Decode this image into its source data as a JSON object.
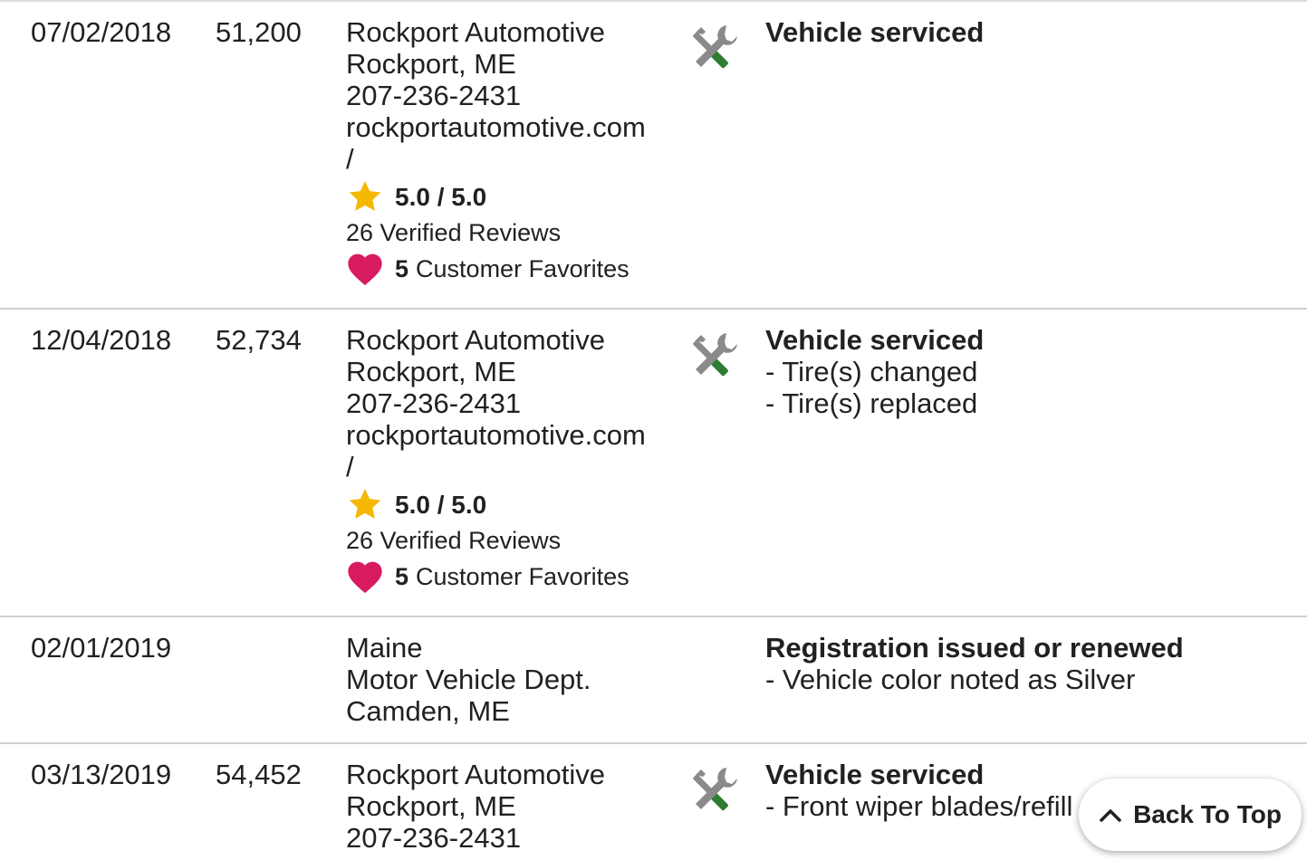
{
  "records": [
    {
      "date": "07/02/2018",
      "odometer": "51,200",
      "source": {
        "name": "Rockport Automotive",
        "location": "Rockport, ME",
        "phone": "207-236-2431",
        "website": "rockportautomotive.com",
        "website_tail": "/",
        "rating": "5.0 / 5.0",
        "reviews": "26 Verified Reviews",
        "favorites_count": "5",
        "favorites_label": "Customer Favorites"
      },
      "icon": "wrench-screwdriver-icon",
      "details": {
        "title": "Vehicle serviced",
        "items": []
      }
    },
    {
      "date": "12/04/2018",
      "odometer": "52,734",
      "source": {
        "name": "Rockport Automotive",
        "location": "Rockport, ME",
        "phone": "207-236-2431",
        "website": "rockportautomotive.com",
        "website_tail": "/",
        "rating": "5.0 / 5.0",
        "reviews": "26 Verified Reviews",
        "favorites_count": "5",
        "favorites_label": "Customer Favorites"
      },
      "icon": "wrench-screwdriver-icon",
      "details": {
        "title": "Vehicle serviced",
        "items": [
          "- Tire(s) changed",
          "- Tire(s) replaced"
        ]
      }
    },
    {
      "date": "02/01/2019",
      "odometer": "",
      "source": {
        "line1": "Maine",
        "line2": "Motor Vehicle Dept.",
        "line3": "Camden, ME"
      },
      "details": {
        "title": "Registration issued or renewed",
        "items": [
          "- Vehicle color noted as Silver"
        ]
      }
    },
    {
      "date": "03/13/2019",
      "odometer": "54,452",
      "source": {
        "name": "Rockport Automotive",
        "location": "Rockport, ME",
        "phone": "207-236-2431"
      },
      "icon": "wrench-screwdriver-icon",
      "details": {
        "title": "Vehicle serviced",
        "items": [
          "- Front wiper blades/refill"
        ]
      }
    }
  ],
  "back_to_top": {
    "label": "Back To Top"
  },
  "colors": {
    "divider": "#cfcfcf",
    "star": "#f5b800",
    "heart": "#d81b60",
    "icon_gray": "#8a8a8a",
    "icon_green": "#2e7d32",
    "text": "#212121"
  }
}
